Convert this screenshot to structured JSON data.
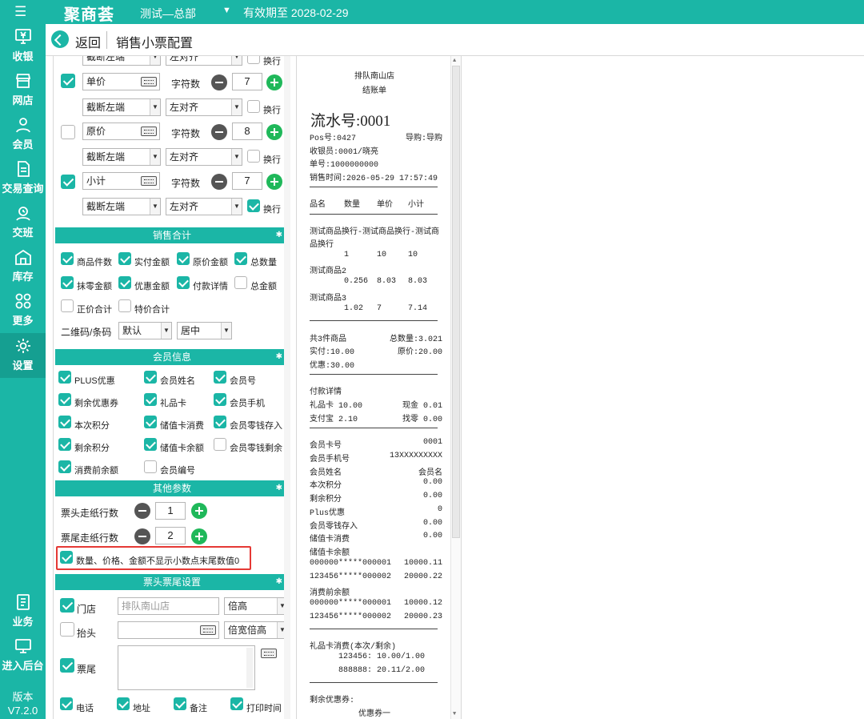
{
  "app": {
    "logo": "聚商荟",
    "store": "测试—总部",
    "expiry": "有效期至 2028-02-29"
  },
  "sidebar": {
    "items": [
      "收银",
      "网店",
      "会员",
      "交易查询",
      "交班",
      "库存",
      "更多",
      "设置",
      "业务",
      "进入后台"
    ],
    "version_label": "版本",
    "version": "V7.2.0"
  },
  "header": {
    "back": "返回",
    "title": "销售小票配置"
  },
  "columns": {
    "top_row": {
      "truncate": "截断左端",
      "align": "左对齐",
      "wrap": "换行"
    },
    "rows": [
      {
        "name": "单价",
        "checked": true,
        "type": "字符数",
        "width": "7",
        "truncate": "截断左端",
        "align": "左对齐",
        "wrap": "换行",
        "wrap_checked": false
      },
      {
        "name": "原价",
        "checked": false,
        "type": "字符数",
        "width": "8",
        "truncate": "截断左端",
        "align": "左对齐",
        "wrap": "换行",
        "wrap_checked": false
      },
      {
        "name": "小计",
        "checked": true,
        "type": "字符数",
        "width": "7",
        "truncate": "截断左端",
        "align": "左对齐",
        "wrap": "换行",
        "wrap_checked": true
      }
    ]
  },
  "sales_total": {
    "title": "销售合计",
    "items": [
      {
        "label": "商品件数",
        "checked": true
      },
      {
        "label": "实付金额",
        "checked": true
      },
      {
        "label": "原价金额",
        "checked": true
      },
      {
        "label": "总数量",
        "checked": true
      },
      {
        "label": "抹零金额",
        "checked": true
      },
      {
        "label": "优惠金额",
        "checked": true
      },
      {
        "label": "付款详情",
        "checked": true
      },
      {
        "label": "总金额",
        "checked": false
      },
      {
        "label": "正价合计",
        "checked": false
      },
      {
        "label": "特价合计",
        "checked": false
      }
    ],
    "qr_label": "二维码/条码",
    "qr_value": "默认",
    "qr_align": "居中"
  },
  "member": {
    "title": "会员信息",
    "items": [
      {
        "label": "PLUS优惠",
        "checked": true
      },
      {
        "label": "会员姓名",
        "checked": true
      },
      {
        "label": "会员号",
        "checked": true
      },
      {
        "label": "剩余优惠券",
        "checked": true
      },
      {
        "label": "礼品卡",
        "checked": true
      },
      {
        "label": "会员手机",
        "checked": true
      },
      {
        "label": "本次积分",
        "checked": true
      },
      {
        "label": "储值卡消费",
        "checked": true
      },
      {
        "label": "会员零钱存入",
        "checked": true
      },
      {
        "label": "剩余积分",
        "checked": true
      },
      {
        "label": "储值卡余额",
        "checked": true
      },
      {
        "label": "会员零钱剩余",
        "checked": false
      },
      {
        "label": "消费前余额",
        "checked": true
      },
      {
        "label": "会员编号",
        "checked": false
      }
    ]
  },
  "other": {
    "title": "其他参数",
    "head_feed_label": "票头走纸行数",
    "head_feed": "1",
    "tail_feed_label": "票尾走纸行数",
    "tail_feed": "2",
    "no_trailing_zero": "数量、价格、金额不显示小数点末尾数值0"
  },
  "headtail": {
    "title": "票头票尾设置",
    "store_label": "门店",
    "store_value": "排队南山店",
    "store_size": "倍高",
    "header_label": "抬头",
    "header_size": "倍宽倍高",
    "footer_label": "票尾",
    "bottom": [
      {
        "label": "电话",
        "checked": true
      },
      {
        "label": "地址",
        "checked": true
      },
      {
        "label": "备注",
        "checked": true
      },
      {
        "label": "打印时间",
        "checked": true
      }
    ]
  },
  "receipt": {
    "store": "排队南山店",
    "type": "结账单",
    "serial": "流水号:0001",
    "pos": "Pos号:0427",
    "guide": "导购:导购",
    "cashier": "收银员:0001/晓亮",
    "order": "单号:1000000000",
    "time": "销售时间:2026-05-29 17:57:49",
    "cols": [
      "品名",
      "数量",
      "单价",
      "小计"
    ],
    "items": [
      {
        "name": "测试商品换行-测试商品换行-测试商",
        "name2": "品换行",
        "qty": "1",
        "price": "10",
        "sub": "10"
      },
      {
        "name": "测试商品2",
        "qty": "0.256",
        "price": "8.03",
        "sub": "8.03"
      },
      {
        "name": "测试商品3",
        "qty": "1.02",
        "price": "7",
        "sub": "7.14"
      }
    ],
    "count": "共3件商品",
    "total_qty": "总数量:3.021",
    "paid": "实付:10.00",
    "orig": "原价:20.00",
    "disc": "优惠:30.00",
    "pay_title": "付款详情",
    "pay1": "礼品卡 10.00",
    "pay2": "现金 0.01",
    "pay3": "支付宝 2.10",
    "pay4": "找零 0.00",
    "mem": [
      [
        "会员卡号",
        "0001"
      ],
      [
        "会员手机号",
        "13XXXXXXXXX"
      ],
      [
        "会员姓名",
        "会员名"
      ],
      [
        "本次积分",
        "0.00"
      ],
      [
        "剩余积分",
        "0.00"
      ],
      [
        "Plus优惠",
        "0"
      ],
      [
        "会员零钱存入",
        "0.00"
      ],
      [
        "储值卡消费",
        "0.00"
      ]
    ],
    "sv_title": "储值卡余额",
    "sv": [
      [
        "000000*****000001",
        "10000.11"
      ],
      [
        "123456*****000002",
        "20000.22"
      ]
    ],
    "pre_title": "消费前余额",
    "pre": [
      [
        "000000*****000001",
        "10000.12"
      ],
      [
        "123456*****000002",
        "20000.23"
      ]
    ],
    "gift_title": "礼品卡消费(本次/剩余)",
    "gift": [
      "123456: 10.00/1.00",
      "888888: 20.11/2.00"
    ],
    "coupon_title": "剩余优惠券:",
    "coupon": "优惠券一"
  }
}
